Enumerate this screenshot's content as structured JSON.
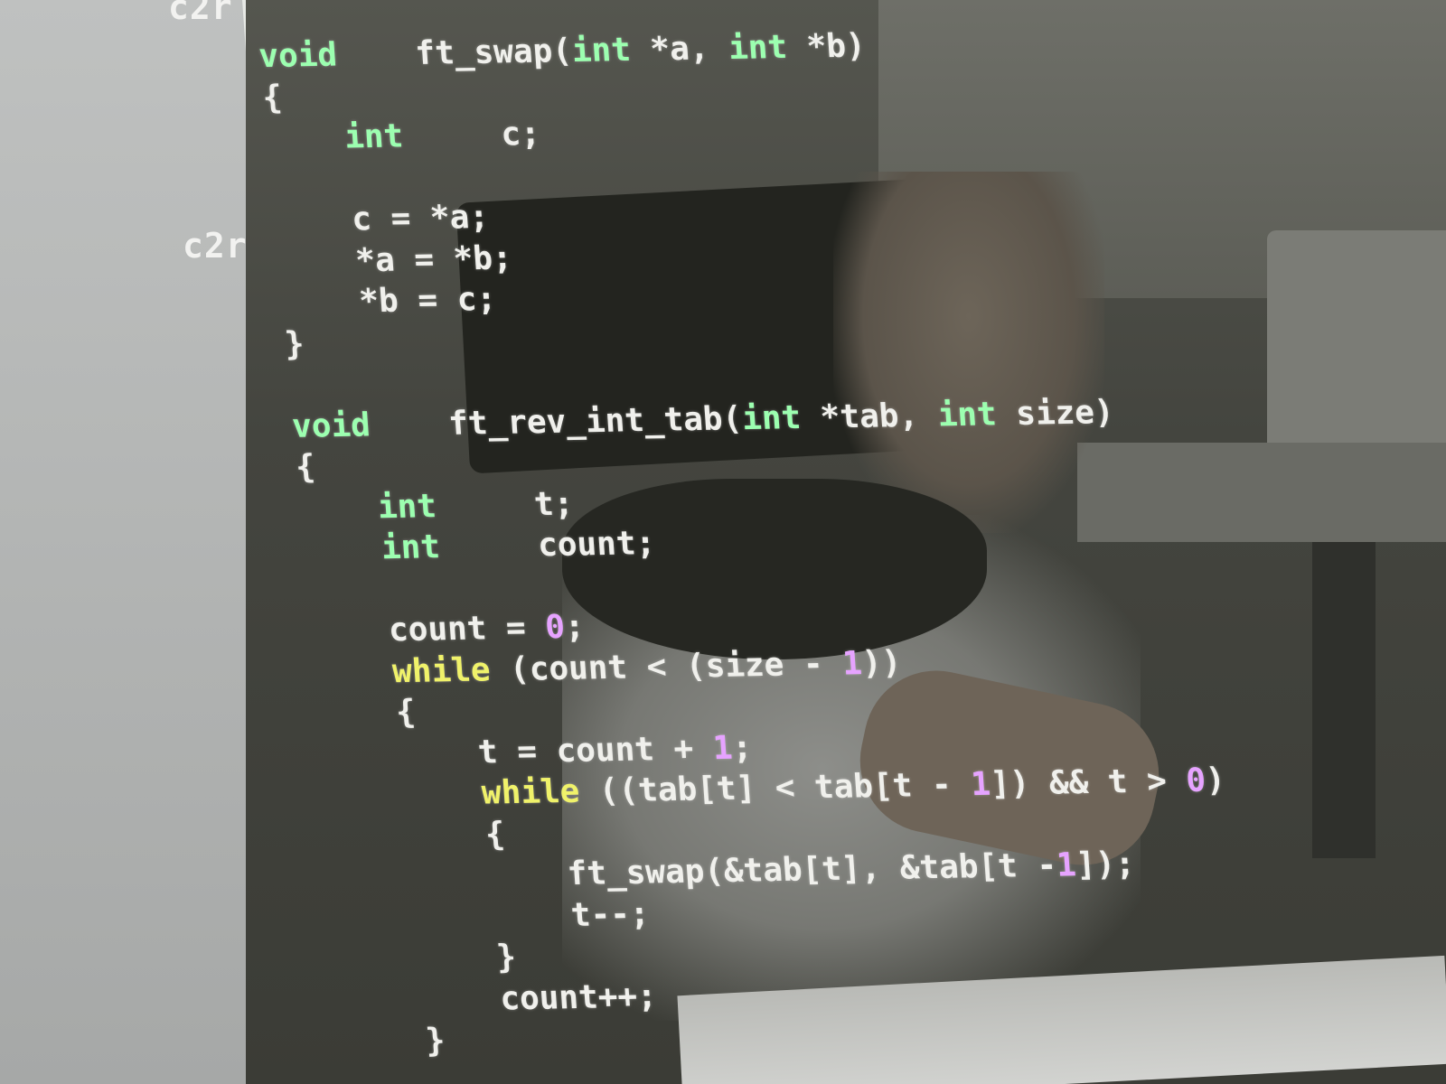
{
  "gutter": {
    "labels": [
      "c2r",
      "c2r"
    ]
  },
  "colors": {
    "type_keyword": "#9cffb0",
    "control_keyword": "#f0f26a",
    "number": "#e6a3ff",
    "plain_text": "#f0f0ec",
    "gutter_background": "#b4b6b5"
  },
  "code": {
    "lines": [
      [
        {
          "t": "void",
          "c": "type"
        },
        {
          "t": "    ft_swap(",
          "c": "plain"
        },
        {
          "t": "int",
          "c": "type"
        },
        {
          "t": " *a, ",
          "c": "plain"
        },
        {
          "t": "int",
          "c": "type"
        },
        {
          "t": " *b)",
          "c": "plain"
        }
      ],
      [
        {
          "t": "{",
          "c": "plain"
        }
      ],
      [
        {
          "t": "    ",
          "c": "plain"
        },
        {
          "t": "int",
          "c": "type"
        },
        {
          "t": "     c;",
          "c": "plain"
        }
      ],
      [
        {
          "t": "",
          "c": "plain"
        }
      ],
      [
        {
          "t": "    c = *a;",
          "c": "plain"
        }
      ],
      [
        {
          "t": "    *a = *b;",
          "c": "plain"
        }
      ],
      [
        {
          "t": "    *b = c;",
          "c": "plain"
        }
      ],
      [
        {
          "t": "}",
          "c": "plain"
        }
      ],
      [
        {
          "t": "",
          "c": "plain"
        }
      ],
      [
        {
          "t": "void",
          "c": "type"
        },
        {
          "t": "    ft_rev_int_tab(",
          "c": "plain"
        },
        {
          "t": "int",
          "c": "type"
        },
        {
          "t": " *tab, ",
          "c": "plain"
        },
        {
          "t": "int",
          "c": "type"
        },
        {
          "t": " size)",
          "c": "plain"
        }
      ],
      [
        {
          "t": "{",
          "c": "plain"
        }
      ],
      [
        {
          "t": "    ",
          "c": "plain"
        },
        {
          "t": "int",
          "c": "type"
        },
        {
          "t": "     t;",
          "c": "plain"
        }
      ],
      [
        {
          "t": "    ",
          "c": "plain"
        },
        {
          "t": "int",
          "c": "type"
        },
        {
          "t": "     count;",
          "c": "plain"
        }
      ],
      [
        {
          "t": "",
          "c": "plain"
        }
      ],
      [
        {
          "t": "    count = ",
          "c": "plain"
        },
        {
          "t": "0",
          "c": "num"
        },
        {
          "t": ";",
          "c": "plain"
        }
      ],
      [
        {
          "t": "    ",
          "c": "plain"
        },
        {
          "t": "while",
          "c": "ctrl"
        },
        {
          "t": " (count < (size - ",
          "c": "plain"
        },
        {
          "t": "1",
          "c": "num"
        },
        {
          "t": "))",
          "c": "plain"
        }
      ],
      [
        {
          "t": "    {",
          "c": "plain"
        }
      ],
      [
        {
          "t": "        t = count + ",
          "c": "plain"
        },
        {
          "t": "1",
          "c": "num"
        },
        {
          "t": ";",
          "c": "plain"
        }
      ],
      [
        {
          "t": "        ",
          "c": "plain"
        },
        {
          "t": "while",
          "c": "ctrl"
        },
        {
          "t": " ((tab[t] < tab[t - ",
          "c": "plain"
        },
        {
          "t": "1",
          "c": "num"
        },
        {
          "t": "]) && t > ",
          "c": "plain"
        },
        {
          "t": "0",
          "c": "num"
        },
        {
          "t": ")",
          "c": "plain"
        }
      ],
      [
        {
          "t": "        {",
          "c": "plain"
        }
      ],
      [
        {
          "t": "            ft_swap(&tab[t], &tab[t -",
          "c": "plain"
        },
        {
          "t": "1",
          "c": "num"
        },
        {
          "t": "]);",
          "c": "plain"
        }
      ],
      [
        {
          "t": "            t--;",
          "c": "plain"
        }
      ],
      [
        {
          "t": "        }",
          "c": "plain"
        }
      ],
      [
        {
          "t": "        count++;",
          "c": "plain"
        }
      ],
      [
        {
          "t": "    }",
          "c": "plain"
        }
      ]
    ]
  }
}
